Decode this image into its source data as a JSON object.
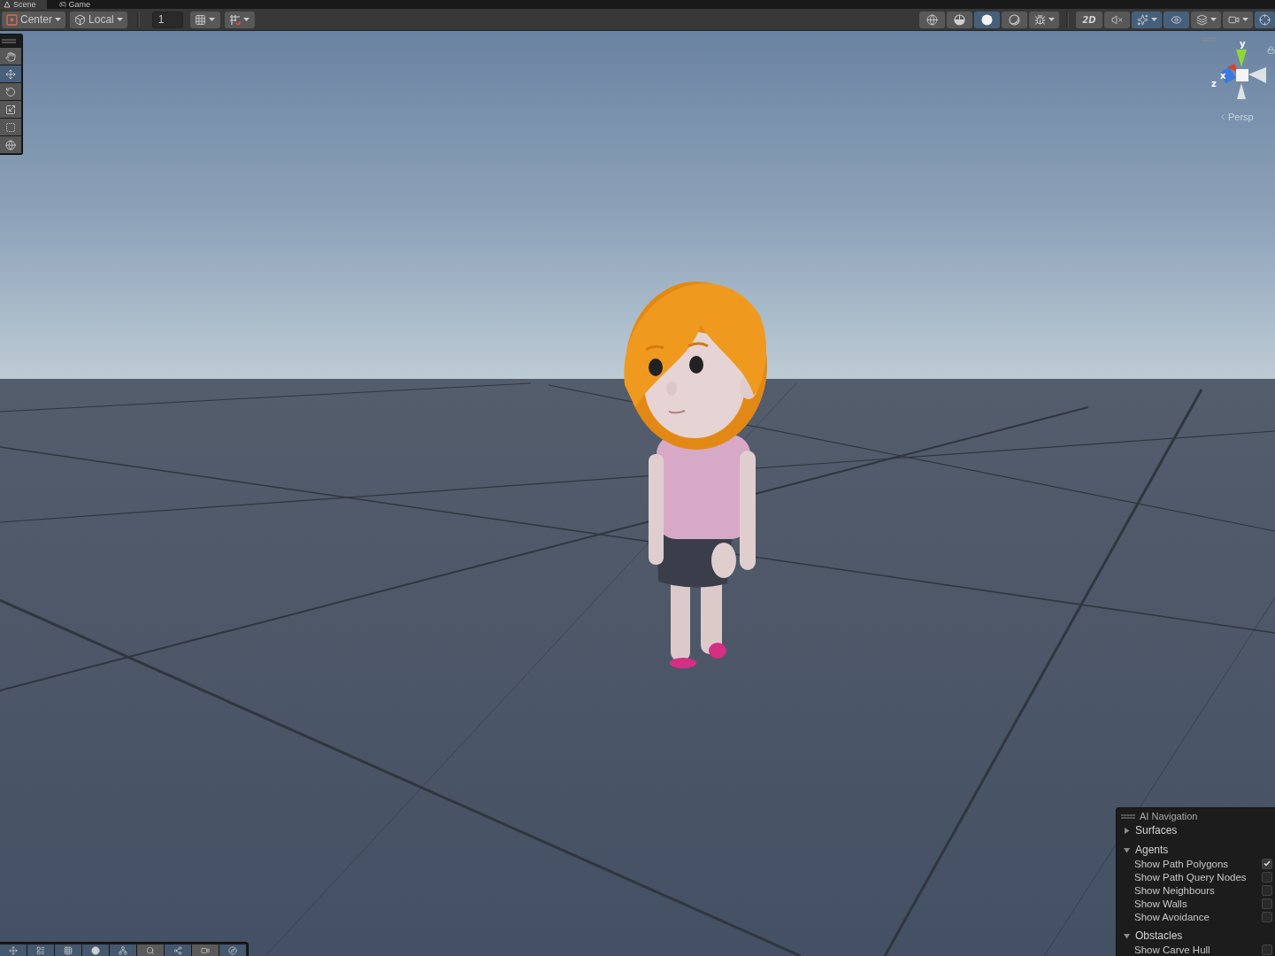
{
  "tabs": [
    {
      "label": "Scene",
      "selected": true
    },
    {
      "label": "Game",
      "selected": false
    }
  ],
  "toolbar": {
    "left": [
      {
        "kind": "dropdown",
        "label": "Center"
      },
      {
        "kind": "dropdown",
        "label": "Local"
      },
      {
        "kind": "separator"
      },
      {
        "kind": "field",
        "value": "1"
      },
      {
        "kind": "split",
        "selected": false
      },
      {
        "kind": "split",
        "selected": false
      }
    ],
    "right": [
      {
        "kind": "toggle",
        "selected": false
      },
      {
        "kind": "toggle",
        "selected": false
      },
      {
        "kind": "toggle",
        "selected": true
      },
      {
        "kind": "toggle",
        "selected": false
      },
      {
        "kind": "split",
        "selected": false
      },
      {
        "kind": "separator"
      },
      {
        "kind": "toggle",
        "label": "2D",
        "selected": false
      },
      {
        "kind": "toggle",
        "selected": false
      },
      {
        "kind": "split",
        "selected": true
      },
      {
        "kind": "toggle",
        "selected": true
      },
      {
        "kind": "split",
        "selected": false
      },
      {
        "kind": "split",
        "selected": false
      },
      {
        "kind": "toggle",
        "selected": true
      }
    ]
  },
  "tools": [
    {
      "selected": false
    },
    {
      "selected": true
    },
    {
      "selected": false
    },
    {
      "selected": false
    },
    {
      "selected": false
    },
    {
      "selected": false
    }
  ],
  "orientation_gizmo": {
    "axis_labels": [
      "y",
      "x",
      "z"
    ],
    "projection": "Persp"
  },
  "nav_panel": {
    "title": "AI Navigation",
    "sections": [
      {
        "label": "Surfaces",
        "expanded": false
      },
      {
        "label": "Agents",
        "expanded": true,
        "items": [
          {
            "label": "Show Path Polygons",
            "checked": true
          },
          {
            "label": "Show Path Query Nodes",
            "checked": false
          },
          {
            "label": "Show Neighbours",
            "checked": false
          },
          {
            "label": "Show Walls",
            "checked": false
          },
          {
            "label": "Show Avoidance",
            "checked": false
          }
        ]
      },
      {
        "label": "Obstacles",
        "expanded": true,
        "items": [
          {
            "label": "Show Carve Hull",
            "checked": false
          }
        ]
      }
    ]
  },
  "overlay_toolbar": [
    {
      "selected": true
    },
    {
      "selected": true
    },
    {
      "selected": true
    },
    {
      "selected": true
    },
    {
      "selected": true
    },
    {
      "selected": false
    },
    {
      "selected": true
    },
    {
      "selected": false
    },
    {
      "selected": true
    }
  ]
}
